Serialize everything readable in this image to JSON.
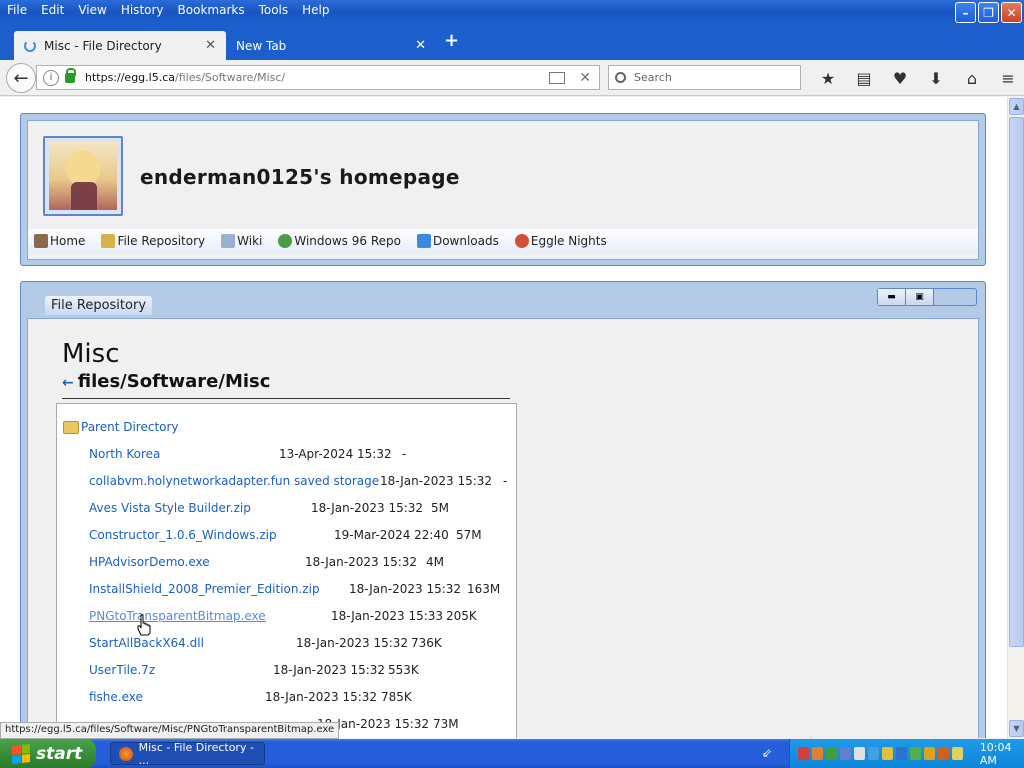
{
  "menu": [
    "File",
    "Edit",
    "View",
    "History",
    "Bookmarks",
    "Tools",
    "Help"
  ],
  "window_buttons": {
    "minimize": "–",
    "maximize": "❐",
    "close": "✕"
  },
  "tabs": [
    {
      "label": "Misc - File Directory",
      "close": "✕"
    },
    {
      "label": "New Tab",
      "close": "✕"
    }
  ],
  "new_tab": "+",
  "nav": {
    "back": "←",
    "info": "i",
    "url_host": "https://egg.l5.ca",
    "url_rest": "/files/Software/Misc/",
    "stop": "✕",
    "search_placeholder": "Search"
  },
  "toolbar_icons": [
    "★",
    "▤",
    "♥",
    "⬇",
    "⌂",
    "≡"
  ],
  "site": {
    "title": "enderman0125's homepage",
    "nav": [
      {
        "label": "Home",
        "icon_color": "#8a6a4a"
      },
      {
        "label": "File Repository",
        "icon_color": "#d8b04a"
      },
      {
        "label": "Wiki",
        "icon_color": "#9ab0d0"
      },
      {
        "label": "Windows 96 Repo",
        "icon_color": "#4a9a4a"
      },
      {
        "label": "Downloads",
        "icon_color": "#3a8ae0"
      },
      {
        "label": "Eggle Nights",
        "icon_color": "#d0503a"
      }
    ]
  },
  "repo": {
    "window_title": "File Repository",
    "controls": [
      "▬",
      "▣"
    ],
    "heading": "Misc",
    "path_arrow": "←",
    "path": "files/Software/Misc",
    "parent": "Parent Directory",
    "files": [
      {
        "name": "North Korea",
        "date": "13-Apr-2024 15:32",
        "size": "-"
      },
      {
        "name": "collabvm.holynetworkadapter.fun saved storage",
        "date": "18-Jan-2023 15:32",
        "size": "-"
      },
      {
        "name": "Aves Vista Style Builder.zip",
        "date": "18-Jan-2023 15:32",
        "size": "5M"
      },
      {
        "name": "Constructor_1.0.6_Windows.zip",
        "date": "19-Mar-2024 22:40",
        "size": "57M"
      },
      {
        "name": "HPAdvisorDemo.exe",
        "date": "18-Jan-2023 15:32",
        "size": "4M"
      },
      {
        "name": "InstallShield_2008_Premier_Edition.zip",
        "date": "18-Jan-2023 15:32",
        "size": "163M"
      },
      {
        "name": "PNGtoTransparentBitmap.exe",
        "date": "18-Jan-2023 15:33",
        "size": "205K"
      },
      {
        "name": "StartAllBackX64.dll",
        "date": "18-Jan-2023 15:32",
        "size": "736K"
      },
      {
        "name": "UserTile.7z",
        "date": "18-Jan-2023 15:32",
        "size": "553K"
      },
      {
        "name": "fishe.exe",
        "date": "18-Jan-2023 15:32",
        "size": "785K"
      },
      {
        "name": "",
        "date": "18-Jan-2023 15:32",
        "size": "73M"
      }
    ]
  },
  "status_url": "https://egg.l5.ca/files/Software/Misc/PNGtoTransparentBitmap.exe",
  "taskbar": {
    "start": "start",
    "task": "Misc - File Directory - ...",
    "clock": "10:04 AM",
    "tray_colors": [
      "#d04040",
      "#e08030",
      "#40a040",
      "#6080d0",
      "#e0e0e0",
      "#40a0e0",
      "#e0c040",
      "#3070d0",
      "#50b050",
      "#e0a020",
      "#d06020",
      "#e0d060"
    ]
  }
}
